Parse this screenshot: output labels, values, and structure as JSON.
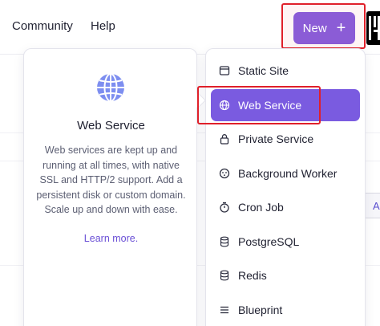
{
  "topbar": {
    "nav": [
      {
        "label": "Community"
      },
      {
        "label": "Help"
      }
    ],
    "new_button": {
      "label": "New",
      "icon": "plus-icon"
    }
  },
  "preview": {
    "icon": "globe-icon",
    "title": "Web Service",
    "description": "Web services are kept up and running at all times, with native SSL and HTTP/2 support. Add a persistent disk or custom domain. Scale up and down with ease.",
    "link": "Learn more."
  },
  "menu": {
    "items": [
      {
        "label": "Static Site",
        "icon": "browser-window-icon",
        "active": false
      },
      {
        "label": "Web Service",
        "icon": "globe-icon",
        "active": true
      },
      {
        "label": "Private Service",
        "icon": "lock-icon",
        "active": false
      },
      {
        "label": "Background Worker",
        "icon": "gauge-icon",
        "active": false
      },
      {
        "label": "Cron Job",
        "icon": "stopwatch-icon",
        "active": false
      },
      {
        "label": "PostgreSQL",
        "icon": "database-icon",
        "active": false
      },
      {
        "label": "Redis",
        "icon": "database-icon",
        "active": false
      },
      {
        "label": "Blueprint",
        "icon": "list-icon",
        "active": false
      }
    ]
  },
  "background": {
    "partial_button": "A"
  },
  "colors": {
    "accent": "#7a5be0",
    "highlight": "#e0202a",
    "link": "#6a4fd6"
  }
}
